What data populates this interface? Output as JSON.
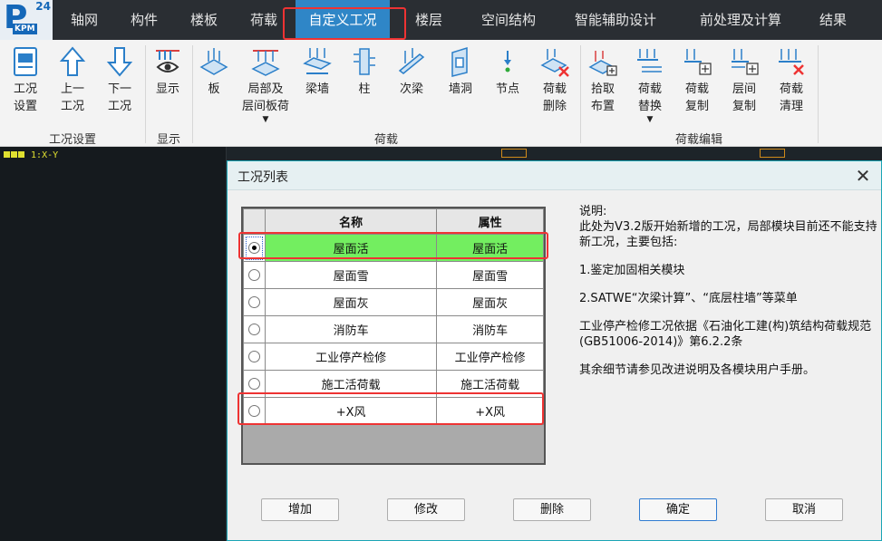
{
  "app": {
    "logo_letter": "P",
    "logo_tag": "KPM",
    "logo_version": "24"
  },
  "menu": {
    "items": [
      {
        "label": "轴网"
      },
      {
        "label": "构件"
      },
      {
        "label": "楼板"
      },
      {
        "label": "荷载"
      },
      {
        "label": "自定义工况"
      },
      {
        "label": "楼层"
      },
      {
        "label": "空间结构"
      },
      {
        "label": "智能辅助设计"
      },
      {
        "label": "前处理及计算"
      },
      {
        "label": "结果"
      }
    ],
    "active": "自定义工况"
  },
  "ribbon": {
    "groups": [
      {
        "label": "工况设置",
        "buttons": [
          {
            "label": "工况\n设置",
            "icon": "case-settings-icon"
          },
          {
            "label": "上一\n工况",
            "icon": "arrow-up-icon"
          },
          {
            "label": "下一\n工况",
            "icon": "arrow-down-icon"
          }
        ]
      },
      {
        "label": "显示",
        "buttons": [
          {
            "label": "显示",
            "icon": "eye-display-icon"
          }
        ]
      },
      {
        "label": "荷载",
        "buttons": [
          {
            "label": "板",
            "icon": "slab-load-icon"
          },
          {
            "label": "局部及\n层间板荷",
            "icon": "local-slab-load-icon"
          },
          {
            "label": "梁墙",
            "icon": "beam-wall-load-icon"
          },
          {
            "label": "柱",
            "icon": "column-load-icon"
          },
          {
            "label": "次梁",
            "icon": "secondary-beam-load-icon"
          },
          {
            "label": "墙洞",
            "icon": "wall-opening-load-icon"
          },
          {
            "label": "节点",
            "icon": "node-load-icon"
          },
          {
            "label": "荷载\n删除",
            "icon": "load-delete-icon"
          }
        ]
      },
      {
        "label": "荷载编辑",
        "buttons": [
          {
            "label": "拾取\n布置",
            "icon": "pick-place-icon"
          },
          {
            "label": "荷载\n替换",
            "icon": "load-replace-icon"
          },
          {
            "label": "荷载\n复制",
            "icon": "load-copy-icon"
          },
          {
            "label": "层间\n复制",
            "icon": "floor-copy-icon"
          },
          {
            "label": "荷载\n清理",
            "icon": "load-clear-icon"
          }
        ]
      }
    ]
  },
  "workspace": {
    "view_label": "1:X-Y"
  },
  "dialog": {
    "title": "工况列表",
    "close_glyph": "✕",
    "table": {
      "headers": [
        "名称",
        "属性"
      ],
      "rows": [
        {
          "name": "屋面活",
          "attr": "屋面活",
          "selected": true
        },
        {
          "name": "屋面雪",
          "attr": "屋面雪",
          "selected": false
        },
        {
          "name": "屋面灰",
          "attr": "屋面灰",
          "selected": false
        },
        {
          "name": "消防车",
          "attr": "消防车",
          "selected": false
        },
        {
          "name": "工业停产检修",
          "attr": "工业停产检修",
          "selected": false
        },
        {
          "name": "施工活荷载",
          "attr": "施工活荷载",
          "selected": false
        },
        {
          "name": "+X风",
          "attr": "+X风",
          "selected": false
        }
      ]
    },
    "description": {
      "heading": "说明:",
      "line1": "此处为V3.2版开始新增的工况，局部模块目前还不能支持新工况，主要包括:",
      "item1": "1.鉴定加固相关模块",
      "item2": "2.SATWE“次梁计算”、“底层柱墙”等菜单",
      "item3": "工业停产检修工况依据《石油化工建(构)筑结构荷载规范(GB51006-2014)》第6.2.2条",
      "item4": "其余细节请参见改进说明及各模块用户手册。"
    },
    "buttons": {
      "add": "增加",
      "modify": "修改",
      "delete": "删除",
      "ok": "确定",
      "cancel": "取消"
    }
  }
}
